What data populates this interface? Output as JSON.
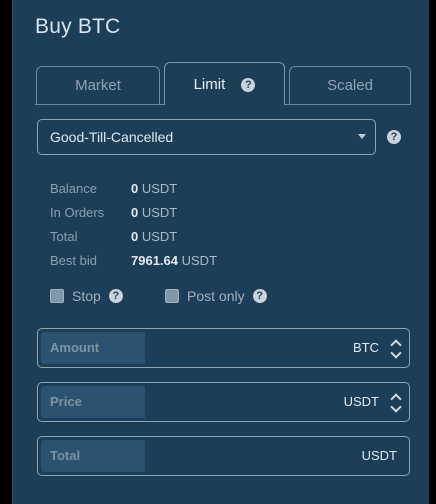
{
  "title": "Buy BTC",
  "tabs": [
    {
      "label": "Market"
    },
    {
      "label": "Limit"
    },
    {
      "label": "Scaled"
    }
  ],
  "help_glyph": "?",
  "time_in_force": {
    "selected": "Good-Till-Cancelled"
  },
  "balances": [
    {
      "label": "Balance",
      "value": "0",
      "currency": "USDT"
    },
    {
      "label": "In Orders",
      "value": "0",
      "currency": "USDT"
    },
    {
      "label": "Total",
      "value": "0",
      "currency": "USDT"
    },
    {
      "label": "Best bid",
      "value": "7961.64",
      "currency": "USDT"
    }
  ],
  "options": {
    "stop_label": "Stop",
    "post_only_label": "Post only"
  },
  "fields": {
    "amount": {
      "label": "Amount",
      "currency": "BTC"
    },
    "price": {
      "label": "Price",
      "currency": "USDT"
    },
    "total": {
      "label": "Total",
      "currency": "USDT"
    }
  },
  "colors": {
    "panel_bg": "#1d3e57",
    "field_label_bg": "#2b5371",
    "border": "#8ea4b3"
  }
}
